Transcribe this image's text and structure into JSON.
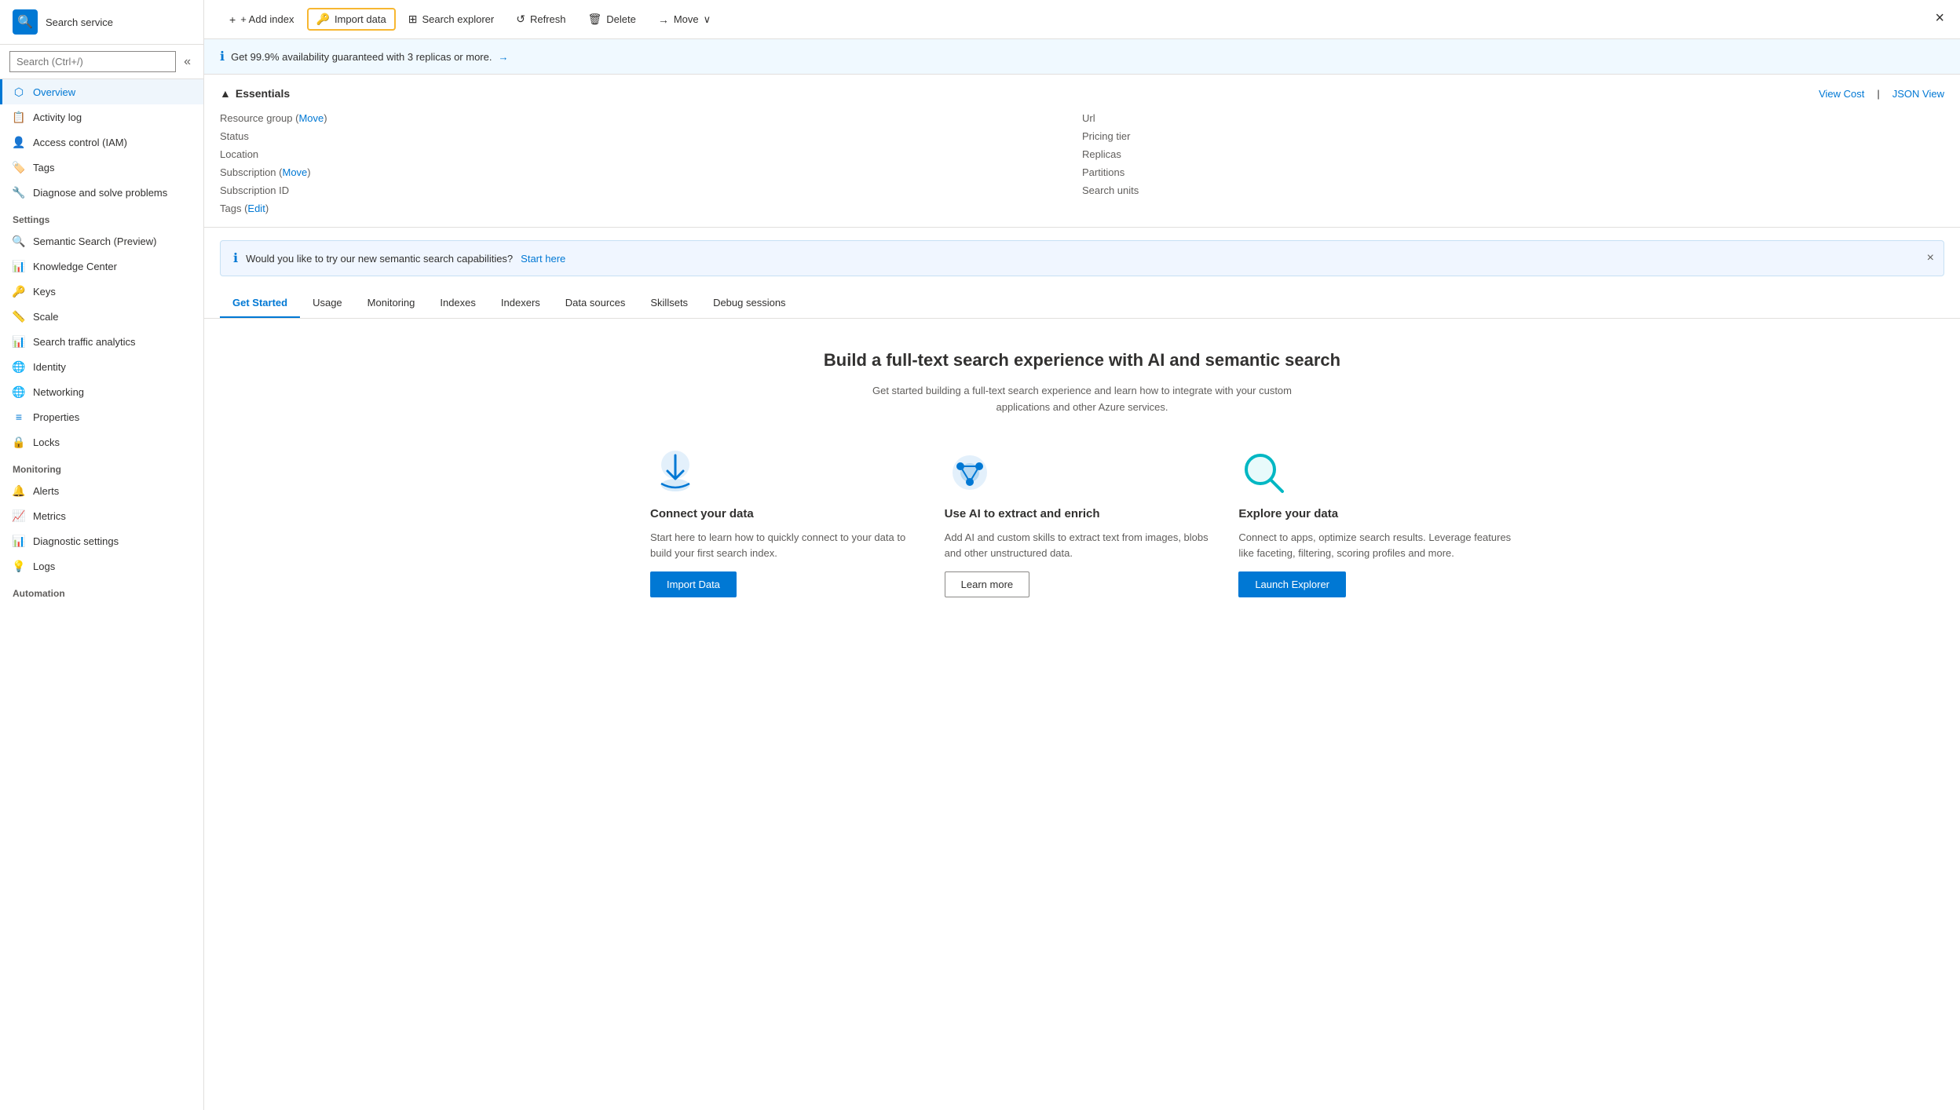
{
  "app": {
    "title": "Search service",
    "logo_icon": "🔍",
    "close_label": "×"
  },
  "sidebar": {
    "search_placeholder": "Search (Ctrl+/)",
    "collapse_icon": "«",
    "items_general": [
      {
        "id": "overview",
        "label": "Overview",
        "icon": "⬡",
        "active": true,
        "color": "#0078d4"
      },
      {
        "id": "activity-log",
        "label": "Activity log",
        "icon": "📋",
        "color": "#0078d4"
      },
      {
        "id": "iam",
        "label": "Access control (IAM)",
        "icon": "👤",
        "color": "#0078d4"
      },
      {
        "id": "tags",
        "label": "Tags",
        "icon": "🏷️",
        "color": "#a4262c"
      },
      {
        "id": "diagnose",
        "label": "Diagnose and solve problems",
        "icon": "🔧",
        "color": "#0078d4"
      }
    ],
    "section_settings": "Settings",
    "items_settings": [
      {
        "id": "semantic-search",
        "label": "Semantic Search (Preview)",
        "icon": "🔍",
        "color": "#0078d4"
      },
      {
        "id": "knowledge-center",
        "label": "Knowledge Center",
        "icon": "📊",
        "color": "#0078d4"
      },
      {
        "id": "keys",
        "label": "Keys",
        "icon": "🔑",
        "color": "#f7b731"
      },
      {
        "id": "scale",
        "label": "Scale",
        "icon": "📏",
        "color": "#0078d4"
      },
      {
        "id": "search-traffic",
        "label": "Search traffic analytics",
        "icon": "📊",
        "color": "#0078d4"
      },
      {
        "id": "identity",
        "label": "Identity",
        "icon": "🌐",
        "color": "#00b7c3"
      },
      {
        "id": "networking",
        "label": "Networking",
        "icon": "🌐",
        "color": "#00b7c3"
      },
      {
        "id": "properties",
        "label": "Properties",
        "icon": "≡",
        "color": "#0078d4"
      },
      {
        "id": "locks",
        "label": "Locks",
        "icon": "🔒",
        "color": "#605e5c"
      }
    ],
    "section_monitoring": "Monitoring",
    "items_monitoring": [
      {
        "id": "alerts",
        "label": "Alerts",
        "icon": "🔔",
        "color": "#f7b731"
      },
      {
        "id": "metrics",
        "label": "Metrics",
        "icon": "📈",
        "color": "#0078d4"
      },
      {
        "id": "diagnostic-settings",
        "label": "Diagnostic settings",
        "icon": "📊",
        "color": "#107c10"
      },
      {
        "id": "logs",
        "label": "Logs",
        "icon": "💡",
        "color": "#0078d4"
      }
    ],
    "section_automation": "Automation"
  },
  "toolbar": {
    "add_index_label": "+ Add index",
    "import_data_label": "Import data",
    "search_explorer_label": "Search explorer",
    "refresh_label": "Refresh",
    "delete_label": "Delete",
    "move_label": "Move",
    "import_icon": "🔑",
    "search_icon": "⊞",
    "refresh_icon": "↺",
    "delete_icon": "🗑",
    "move_icon": "→"
  },
  "banner": {
    "icon": "ℹ",
    "text": "Get 99.9% availability guaranteed with 3 replicas or more.",
    "link_text": "→"
  },
  "essentials": {
    "title": "Essentials",
    "collapse_icon": "▲",
    "view_cost_label": "View Cost",
    "json_view_label": "JSON View",
    "left_fields": [
      {
        "label": "Resource group",
        "value": "",
        "link_text": "Move",
        "has_link": true
      },
      {
        "label": "Status",
        "value": ""
      },
      {
        "label": "Location",
        "value": ""
      },
      {
        "label": "Subscription",
        "value": "",
        "link_text": "Move",
        "has_link": true
      },
      {
        "label": "Subscription ID",
        "value": ""
      },
      {
        "label": "Tags",
        "value": "",
        "link_text": "Edit",
        "has_link": true
      }
    ],
    "right_fields": [
      {
        "label": "Url",
        "value": ""
      },
      {
        "label": "Pricing tier",
        "value": ""
      },
      {
        "label": "Replicas",
        "value": ""
      },
      {
        "label": "Partitions",
        "value": ""
      },
      {
        "label": "Search units",
        "value": ""
      }
    ]
  },
  "semantic_banner": {
    "icon": "ℹ",
    "text": "Would you like to try our new semantic search capabilities?",
    "link_text": "Start here",
    "close_icon": "×"
  },
  "tabs": [
    {
      "id": "get-started",
      "label": "Get Started",
      "active": true
    },
    {
      "id": "usage",
      "label": "Usage",
      "active": false
    },
    {
      "id": "monitoring",
      "label": "Monitoring",
      "active": false
    },
    {
      "id": "indexes",
      "label": "Indexes",
      "active": false
    },
    {
      "id": "indexers",
      "label": "Indexers",
      "active": false
    },
    {
      "id": "data-sources",
      "label": "Data sources",
      "active": false
    },
    {
      "id": "skillsets",
      "label": "Skillsets",
      "active": false
    },
    {
      "id": "debug-sessions",
      "label": "Debug sessions",
      "active": false
    }
  ],
  "get_started": {
    "title": "Build a full-text search experience with AI and semantic search",
    "subtitle": "Get started building a full-text search experience and learn how to integrate with your custom applications and other Azure services.",
    "cards": [
      {
        "id": "connect-data",
        "icon": "⬆️",
        "icon_color": "#0078d4",
        "title": "Connect your data",
        "description": "Start here to learn how to quickly connect to your data to build your first search index.",
        "button_label": "Import Data",
        "button_type": "primary"
      },
      {
        "id": "use-ai",
        "icon": "🧠",
        "icon_color": "#0078d4",
        "title": "Use AI to extract and enrich",
        "description": "Add AI and custom skills to extract text from images, blobs and other unstructured data.",
        "button_label": "Learn more",
        "button_type": "secondary"
      },
      {
        "id": "explore-data",
        "icon": "🔍",
        "icon_color": "#00b7c3",
        "title": "Explore your data",
        "description": "Connect to apps, optimize search results. Leverage features like faceting, filtering, scoring profiles and more.",
        "button_label": "Launch Explorer",
        "button_type": "primary"
      }
    ]
  }
}
